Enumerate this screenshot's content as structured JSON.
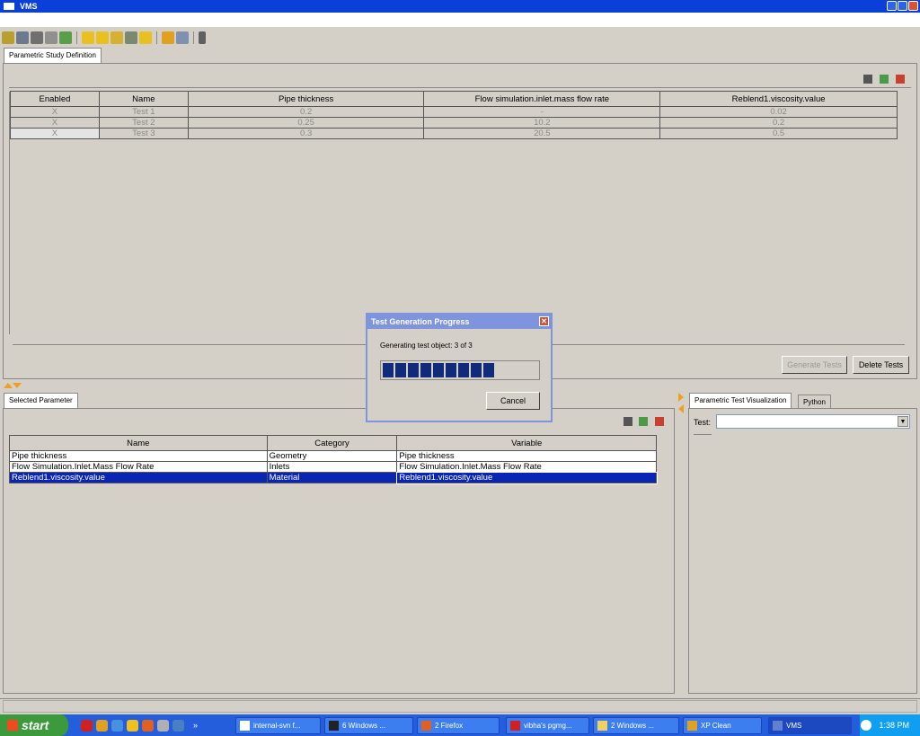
{
  "window": {
    "title": "VMS"
  },
  "colors": {
    "titlebar": "#0a3fd8",
    "selection": "#0a24b4",
    "progress": "#0f2b7a",
    "taskbar": "#245edc",
    "start": "#3c9a3c"
  },
  "study": {
    "tab": "Parametric Study Definition",
    "columns": [
      "Enabled",
      "Name",
      "Pipe thickness",
      "Flow simulation.inlet.mass flow rate",
      "Reblend1.viscosity.value"
    ],
    "rows": [
      [
        "X",
        "Test 1",
        "0.2",
        "-",
        "0.02"
      ],
      [
        "X",
        "Test 2",
        "0.25",
        "10.2",
        "0.2"
      ],
      [
        "X",
        "Test 3",
        "0.3",
        "20.5",
        "0.5"
      ]
    ],
    "generate_button": "Generate Tests",
    "delete_button": "Delete Tests"
  },
  "dialog": {
    "title": "Test Generation Progress",
    "message": "Generating test object: 3 of 3",
    "progress": 0.75,
    "cancel": "Cancel"
  },
  "selected": {
    "tab": "Selected Parameter",
    "columns": [
      "Name",
      "Category",
      "Variable"
    ],
    "rows": [
      [
        "Pipe  thickness",
        "Geometry",
        "Pipe  thickness"
      ],
      [
        "Flow  Simulation.Inlet.Mass Flow Rate",
        "Inlets",
        "Flow  Simulation.Inlet.Mass Flow Rate"
      ],
      [
        "Reblend1.viscosity.value",
        "Material",
        "Reblend1.viscosity.value"
      ]
    ],
    "selected_row": 2
  },
  "viz": {
    "tab": "Parametric Test Visualization",
    "tab2": "Python",
    "test_label": "Test:",
    "test_value": ""
  },
  "taskbar": {
    "start": "start",
    "tasks": [
      {
        "label": "internal-svn f..."
      },
      {
        "label": "6 Windows ..."
      },
      {
        "label": "2 Firefox"
      },
      {
        "label": "vibha's pgmg..."
      },
      {
        "label": "2 Windows ..."
      },
      {
        "label": "XP Clean"
      },
      {
        "label": "VMS"
      }
    ],
    "clock": "1:38 PM"
  }
}
